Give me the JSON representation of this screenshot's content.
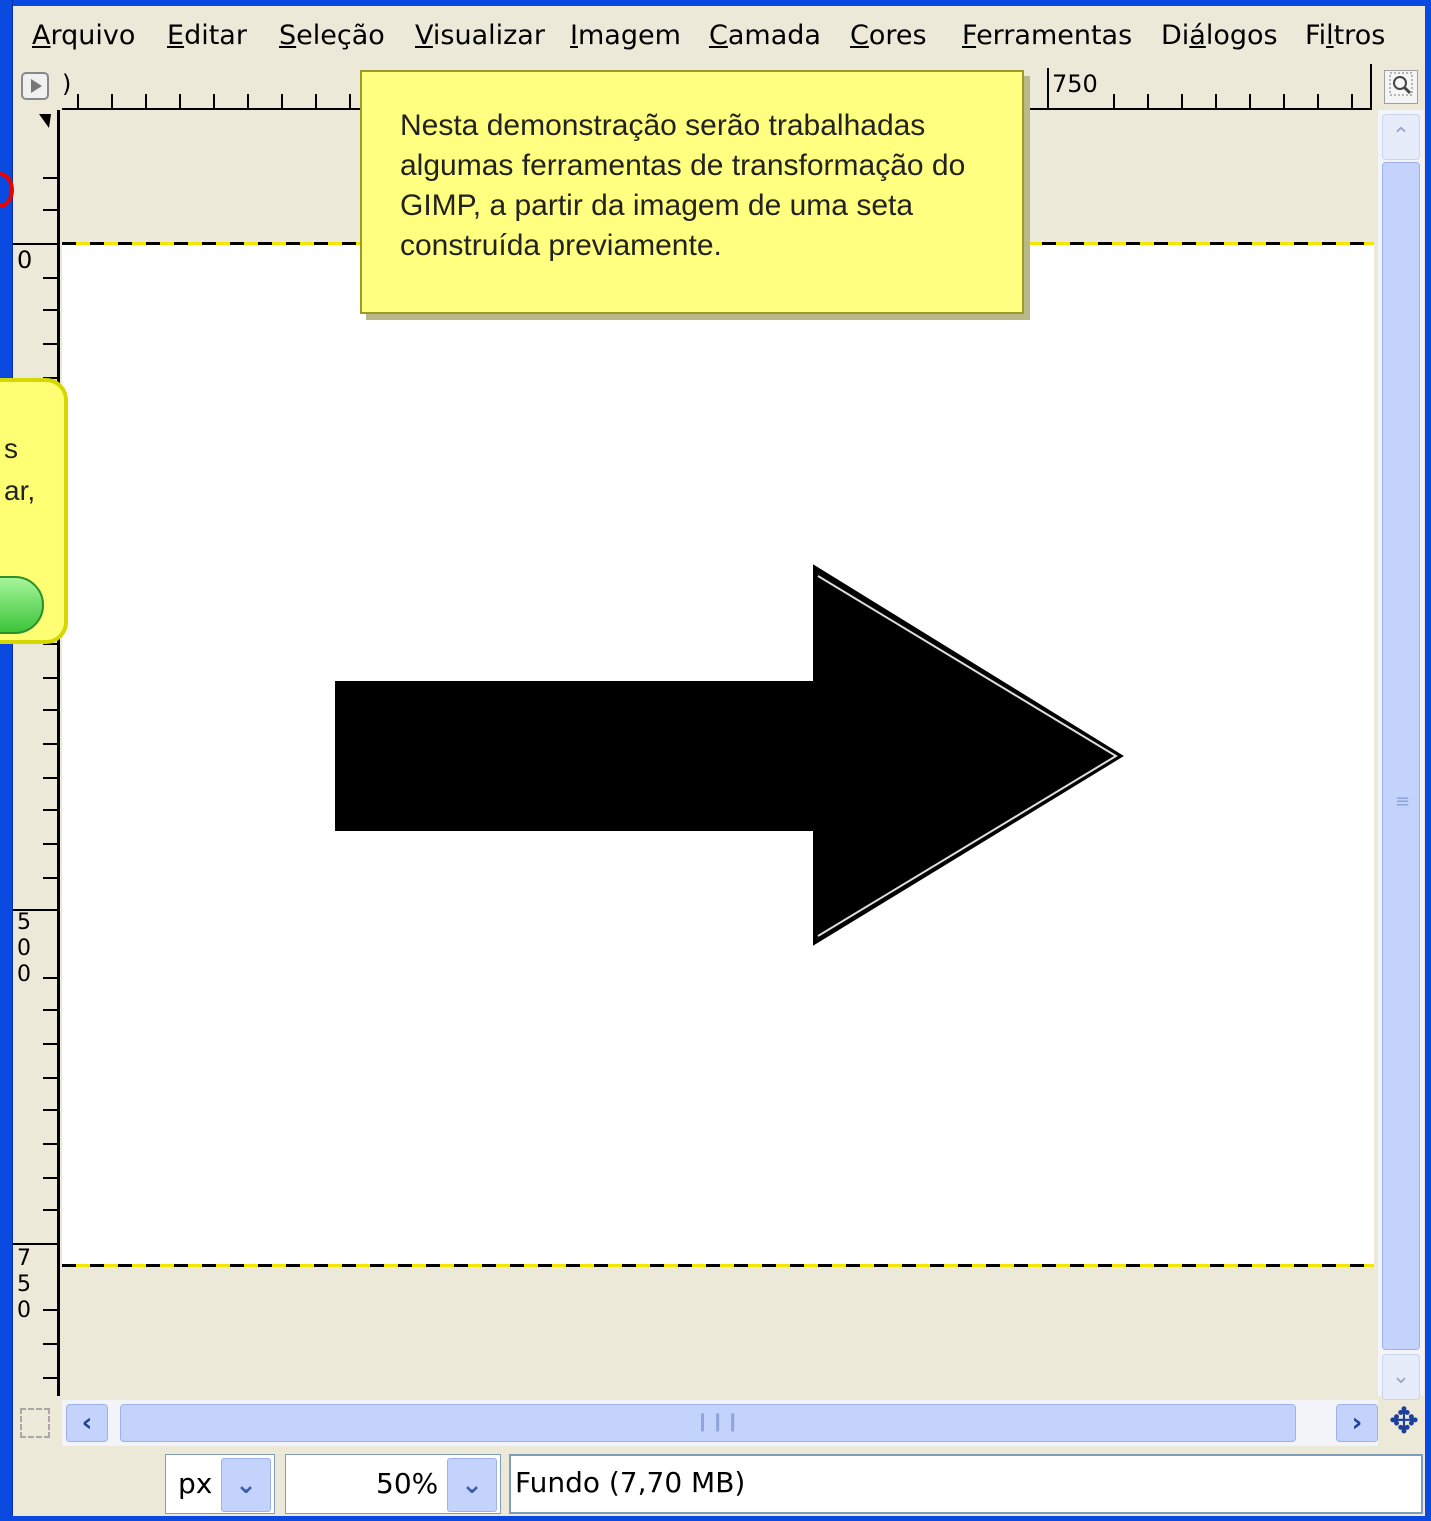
{
  "menu": {
    "items": [
      {
        "pre": "",
        "u": "A",
        "post": "rquivo"
      },
      {
        "pre": "",
        "u": "E",
        "post": "ditar"
      },
      {
        "pre": "",
        "u": "S",
        "post": "eleção"
      },
      {
        "pre": "",
        "u": "V",
        "post": "isualizar"
      },
      {
        "pre": "",
        "u": "I",
        "post": "magem"
      },
      {
        "pre": "",
        "u": "C",
        "post": "amada"
      },
      {
        "pre": "",
        "u": "C",
        "post": "ores"
      },
      {
        "pre": "",
        "u": "F",
        "post": "erramentas"
      },
      {
        "pre": "Di",
        "u": "á",
        "post": "logos"
      },
      {
        "pre": "Fi",
        "u": "l",
        "post": "tros"
      }
    ]
  },
  "ruler": {
    "h_label_start": ")",
    "h_label_750": "750",
    "v_label_0": "0",
    "v_label_500": [
      "5",
      "0",
      "0"
    ],
    "v_label_750": [
      "7",
      "5",
      "0"
    ]
  },
  "tooltip_main": {
    "text": "Nesta demonstração serão trabalhadas algumas ferramentas de transformação do GIMP, a partir da imagem de uma seta construída previamente."
  },
  "tooltip_left": {
    "line1": "s",
    "line2": "ar,"
  },
  "statusbar": {
    "unit": "px",
    "zoom": "50%",
    "layer_info": "Fundo (7,70 MB)"
  },
  "icons": {
    "ruler_menu": "play-icon",
    "zoom_fit": "zoom-icon",
    "quick_mask": "quick-mask-icon",
    "navigate": "move-icon",
    "scroll_left": "chevron-left-icon",
    "scroll_right": "chevron-right-icon",
    "scroll_up": "chevron-up-icon",
    "scroll_down": "chevron-down-icon"
  },
  "colors": {
    "tooltip_bg": "#ffff80",
    "window_border": "#0a49e0",
    "scrollbar": "#c3d3fb"
  }
}
